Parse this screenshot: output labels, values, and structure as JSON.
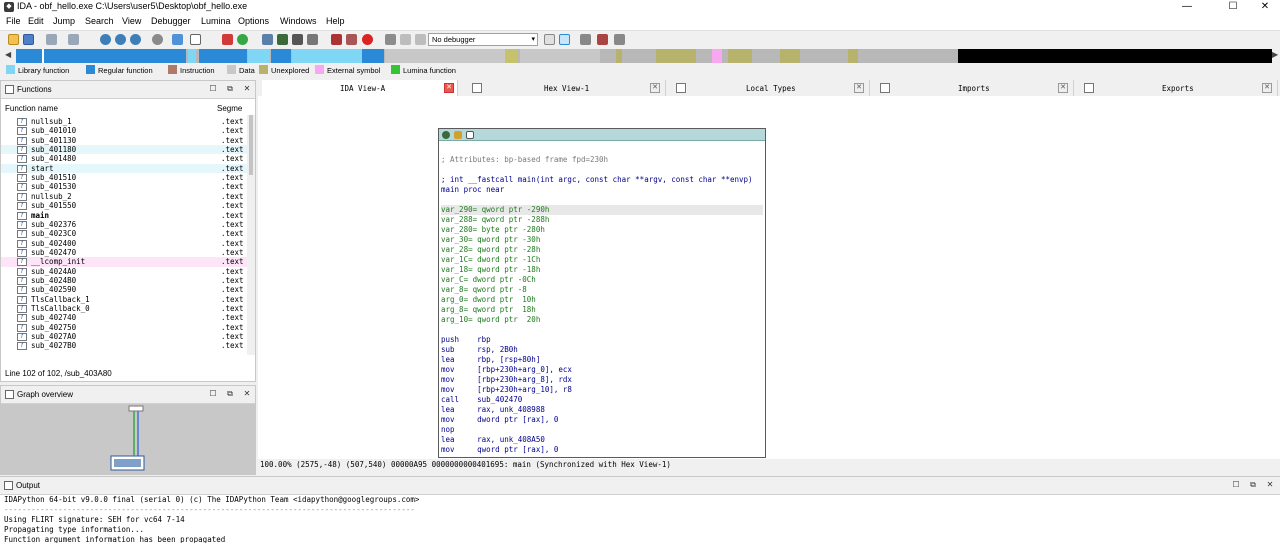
{
  "titlebar": {
    "title": "IDA - obf_hello.exe C:\\Users\\user5\\Desktop\\obf_hello.exe",
    "minimize": "—",
    "maximize": "☐",
    "close": "✕"
  },
  "menu": [
    "File",
    "Edit",
    "Jump",
    "Search",
    "View",
    "Debugger",
    "Lumina",
    "Options",
    "Windows",
    "Help"
  ],
  "toolbar": {
    "debugger_value": "No debugger"
  },
  "navband": {
    "left_arrow": "◀",
    "right_arrow": "▶"
  },
  "legend": [
    {
      "label": "Library function",
      "color": "#7fd7f5"
    },
    {
      "label": "Regular function",
      "color": "#2b8ad7"
    },
    {
      "label": "Instruction",
      "color": "#b07a6a"
    },
    {
      "label": "Data",
      "color": "#c8c8c8"
    },
    {
      "label": "Unexplored",
      "color": "#b7b36c"
    },
    {
      "label": "External symbol",
      "color": "#f7a8f0"
    },
    {
      "label": "Lumina function",
      "color": "#35c435"
    }
  ],
  "functions": {
    "title": "Functions",
    "col_name": "Function name",
    "col_segment": "Segme",
    "status": "Line 102 of 102, /sub_403A80",
    "rows": [
      {
        "name": "nullsub_1",
        "seg": ".text",
        "hl": ""
      },
      {
        "name": "sub_401010",
        "seg": ".text",
        "hl": ""
      },
      {
        "name": "sub_401130",
        "seg": ".text",
        "hl": ""
      },
      {
        "name": "sub_401180",
        "seg": ".text",
        "hl": "#e6f7fb"
      },
      {
        "name": "sub_401480",
        "seg": ".text",
        "hl": ""
      },
      {
        "name": "start",
        "seg": ".text",
        "hl": "#e6f7fb"
      },
      {
        "name": "sub_401510",
        "seg": ".text",
        "hl": ""
      },
      {
        "name": "sub_401530",
        "seg": ".text",
        "hl": ""
      },
      {
        "name": "nullsub_2",
        "seg": ".text",
        "hl": ""
      },
      {
        "name": "sub_401550",
        "seg": ".text",
        "hl": ""
      },
      {
        "name": "main",
        "seg": ".text",
        "hl": "",
        "bold": true
      },
      {
        "name": "sub_402376",
        "seg": ".text",
        "hl": ""
      },
      {
        "name": "sub_4023C0",
        "seg": ".text",
        "hl": ""
      },
      {
        "name": "sub_402400",
        "seg": ".text",
        "hl": ""
      },
      {
        "name": "sub_402470",
        "seg": ".text",
        "hl": ""
      },
      {
        "name": "__lcomp_init",
        "seg": ".text",
        "hl": "#fde4f6"
      },
      {
        "name": "sub_4024A0",
        "seg": ".text",
        "hl": ""
      },
      {
        "name": "sub_4024B0",
        "seg": ".text",
        "hl": ""
      },
      {
        "name": "sub_402590",
        "seg": ".text",
        "hl": ""
      },
      {
        "name": "TlsCallback_1",
        "seg": ".text",
        "hl": ""
      },
      {
        "name": "TlsCallback_0",
        "seg": ".text",
        "hl": ""
      },
      {
        "name": "sub_402740",
        "seg": ".text",
        "hl": ""
      },
      {
        "name": "sub_402750",
        "seg": ".text",
        "hl": ""
      },
      {
        "name": "sub_4027A0",
        "seg": ".text",
        "hl": ""
      },
      {
        "name": "sub_4027B0",
        "seg": ".text",
        "hl": ""
      }
    ]
  },
  "graph_overview": {
    "title": "Graph overview"
  },
  "tabs": [
    {
      "label": "IDA View-A",
      "active": true
    },
    {
      "label": "Hex View-1",
      "active": false
    },
    {
      "label": "Local Types",
      "active": false
    },
    {
      "label": "Imports",
      "active": false
    },
    {
      "label": "Exports",
      "active": false
    }
  ],
  "disasm": {
    "lines": [
      {
        "t": "",
        "cls": ""
      },
      {
        "t": "; Attributes: bp-based frame fpd=230h",
        "cls": "cmt"
      },
      {
        "t": "",
        "cls": ""
      },
      {
        "t": "; int __fastcall main(int argc, const char **argv, const char **envp)",
        "cls": "blue"
      },
      {
        "t": "main proc near",
        "cls": "blue"
      },
      {
        "t": "",
        "cls": ""
      },
      {
        "t": "var_290= qword ptr -290h",
        "cls": "var hl"
      },
      {
        "t": "var_288= qword ptr -288h",
        "cls": "var"
      },
      {
        "t": "var_280= byte ptr -280h",
        "cls": "var"
      },
      {
        "t": "var_30= qword ptr -30h",
        "cls": "var"
      },
      {
        "t": "var_28= qword ptr -28h",
        "cls": "var"
      },
      {
        "t": "var_1C= dword ptr -1Ch",
        "cls": "var"
      },
      {
        "t": "var_18= qword ptr -18h",
        "cls": "var"
      },
      {
        "t": "var_C= dword ptr -0Ch",
        "cls": "var"
      },
      {
        "t": "var_8= qword ptr -8",
        "cls": "var"
      },
      {
        "t": "arg_0= dword ptr  10h",
        "cls": "var"
      },
      {
        "t": "arg_8= qword ptr  18h",
        "cls": "var"
      },
      {
        "t": "arg_10= qword ptr  20h",
        "cls": "var"
      },
      {
        "t": "",
        "cls": ""
      },
      {
        "t": "push    rbp",
        "cls": "ins"
      },
      {
        "t": "sub     rsp, 2B0h",
        "cls": "ins"
      },
      {
        "t": "lea     rbp, [rsp+80h]",
        "cls": "ins"
      },
      {
        "t": "mov     [rbp+230h+arg_0], ecx",
        "cls": "ins"
      },
      {
        "t": "mov     [rbp+230h+arg_8], rdx",
        "cls": "ins"
      },
      {
        "t": "mov     [rbp+230h+arg_10], r8",
        "cls": "ins"
      },
      {
        "t": "call    sub_402470",
        "cls": "ins"
      },
      {
        "t": "lea     rax, unk_408988",
        "cls": "ins"
      },
      {
        "t": "mov     dword ptr [rax], 0",
        "cls": "ins"
      },
      {
        "t": "nop",
        "cls": "ins"
      },
      {
        "t": "lea     rax, unk_408A50",
        "cls": "ins"
      },
      {
        "t": "mov     qword ptr [rax], 0",
        "cls": "ins"
      }
    ],
    "status": "100.00% (2575,-48) (507,540) 00000A95 0000000000401695: main (Synchronized with Hex View-1)"
  },
  "output": {
    "title": "Output",
    "lines": [
      {
        "t": "IDAPython 64-bit v9.0.0 final (serial 0) (c) The IDAPython Team <idapython@googlegroups.com>",
        "cls": ""
      },
      {
        "t": "-------------------------------------------------------------------------------------------",
        "cls": "sep"
      },
      {
        "t": "Using FLIRT signature: SEH for vc64 7-14",
        "cls": ""
      },
      {
        "t": "Propagating type information...",
        "cls": ""
      },
      {
        "t": "Function argument information has been propagated",
        "cls": ""
      }
    ]
  },
  "colors": {
    "regular": "#2b8ad7",
    "library": "#7fd7f5",
    "unexplored": "#b7b36c",
    "data": "#c8c8c8",
    "external": "#f7a8f0",
    "black": "#000000"
  }
}
